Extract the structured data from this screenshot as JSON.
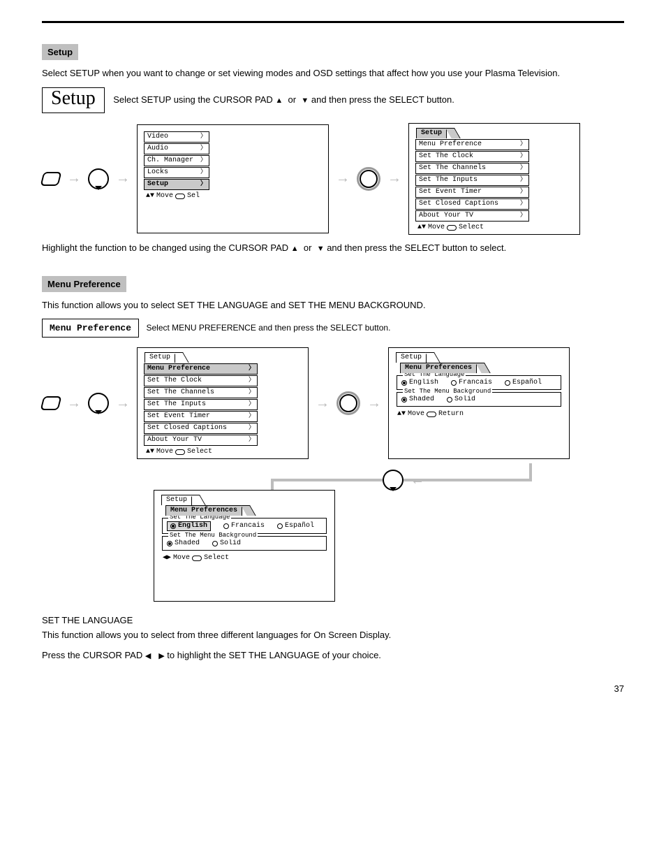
{
  "section_banner": "Setup",
  "intro_line": "Select SETUP when you want to change or set viewing modes and OSD settings that affect how you use your Plasma Television.",
  "setup_box_label": "Setup",
  "after_setup_text_1": "Select SETUP using the CURSOR PAD ",
  "after_setup_text_2": " and then press the SELECT button.",
  "tri_up": "▲",
  "tri_down": "▼",
  "tri_left": "◀",
  "tri_right": "▶",
  "main_menu": {
    "items": [
      "Video",
      "Audio",
      "Ch. Manager",
      "Locks",
      "Setup"
    ],
    "highlight": "Setup",
    "hint_move": "Move",
    "hint_sel": "Sel"
  },
  "setup_menu": {
    "tab": "Setup",
    "items": [
      "Menu Preference",
      "Set The Clock",
      "Set The Channels",
      "Set The Inputs",
      "Set Event Timer",
      "Set Closed Captions",
      "About Your TV"
    ],
    "highlight": "",
    "hint_move": "Move",
    "hint_sel": "Select"
  },
  "setup_menu_p2": {
    "tab": "Setup",
    "items": [
      "Menu Preference",
      "Set The Clock",
      "Set The Channels",
      "Set The Inputs",
      "Set Event Timer",
      "Set Closed Captions",
      "About Your TV"
    ],
    "highlight": "Menu Preference",
    "hint_move": "Move",
    "hint_sel": "Select"
  },
  "pref_screen_a": {
    "crumb1": "Setup",
    "crumb2": "Menu Preferences",
    "lang_legend": "Set The Language",
    "langs": [
      "English",
      "Francais",
      "Español"
    ],
    "bg_legend": "Set The Menu Background",
    "bgs": [
      "Shaded",
      "Solid"
    ],
    "hint_move": "Move",
    "hint_sel": "Return"
  },
  "pref_screen_b": {
    "crumb1": "Setup",
    "crumb2": "Menu Preferences",
    "lang_legend": "Set The Language",
    "langs": [
      "English",
      "Francais",
      "Español"
    ],
    "bg_legend": "Set The Menu Background",
    "bgs": [
      "Shaded",
      "Solid"
    ],
    "hint_move": "Move",
    "hint_sel": "Select"
  },
  "para2_1": "Highlight the function to be changed using the CURSOR PAD ",
  "para2_2": " and then press the SELECT button to select.",
  "sub_heading": "Menu Preference",
  "sub_box_label": "Menu Preference",
  "sub_after_1": "This function allows you to select SET THE LANGUAGE and SET THE MENU BACKGROUND.",
  "sub_after_2": " Select MENU PREFERENCE and then press the SELECT button.",
  "lang_para_title": "SET THE LANGUAGE",
  "lang_para_1": "This function allows you to select from three different languages for On Screen Display.",
  "lang_para_2_a": "Press the CURSOR PAD  ",
  "lang_para_2_b": "  to highlight the SET THE LANGUAGE of your choice.",
  "page_number": "37"
}
